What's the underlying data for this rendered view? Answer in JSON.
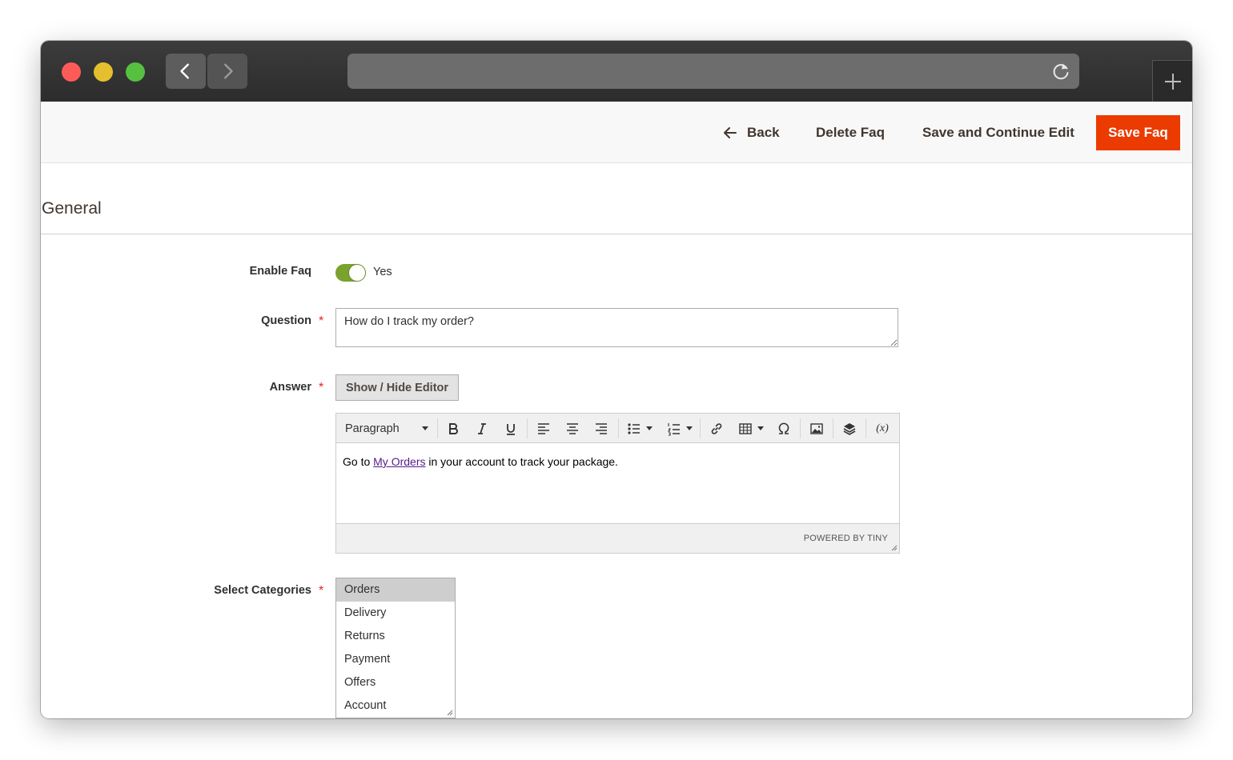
{
  "actions": {
    "back": "Back",
    "delete": "Delete Faq",
    "save_continue": "Save and Continue Edit",
    "save": "Save Faq"
  },
  "section": {
    "title": "General"
  },
  "form": {
    "enable": {
      "label": "Enable Faq",
      "value": "Yes",
      "enabled": true
    },
    "question": {
      "label": "Question",
      "required_mark": "*",
      "value": "How do I track my order?"
    },
    "answer": {
      "label": "Answer",
      "required_mark": "*",
      "toggle_editor": "Show / Hide Editor",
      "format_select": "Paragraph",
      "content_before": "Go to ",
      "content_link": "My Orders",
      "content_after": " in your account to track your package.",
      "status": "POWERED BY TINY",
      "variable_button": "(x)"
    },
    "categories": {
      "label": "Select Categories",
      "required_mark": "*",
      "options": [
        "Orders",
        "Delivery",
        "Returns",
        "Payment",
        "Offers",
        "Account"
      ],
      "selected": "Orders"
    }
  },
  "colors": {
    "primary_button": "#eb3b00",
    "toggle_on": "#79a22e",
    "required": "#e22626",
    "link": "#551a8b"
  }
}
